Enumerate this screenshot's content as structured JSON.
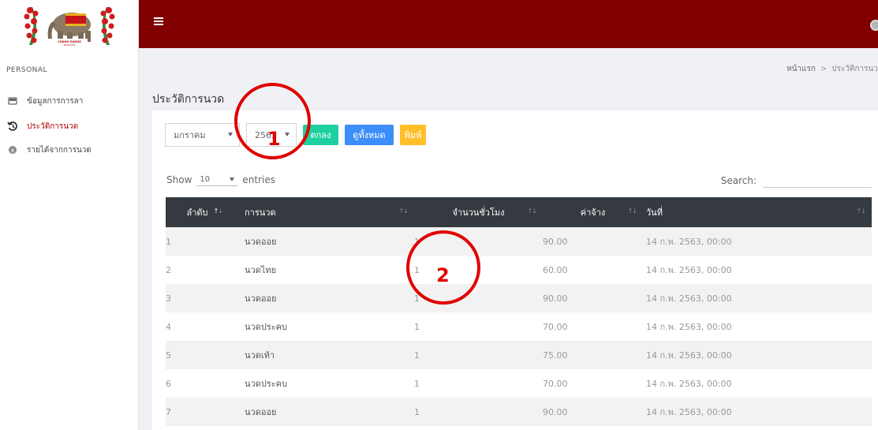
{
  "sidebar": {
    "logo_text": "CHANG DAENG MASSAGE",
    "section_label": "PERSONAL",
    "items": [
      {
        "label": "ข้อมูลการการลา",
        "icon": "card-icon",
        "active": false
      },
      {
        "label": "ประวัติการนวด",
        "icon": "history-icon",
        "active": true
      },
      {
        "label": "รายได้จากการนวด",
        "icon": "coin-icon",
        "active": false
      }
    ]
  },
  "topbar": {
    "menu_icon": "hamburger-icon",
    "avatar_icon": "user-avatar-icon",
    "color": "#800000"
  },
  "breadcrumb": {
    "home": "หน้าแรก",
    "separator": ">",
    "current": "ประวัติการนว"
  },
  "page": {
    "title": "ประวัติการนวด"
  },
  "filters": {
    "month": "มกราคม",
    "year": "2563",
    "ok_button": "ตกลง",
    "view_all_button": "ดูทั้งหมด",
    "print_button": "พิมพ์"
  },
  "datatable": {
    "show_label": "Show",
    "length_value": "10",
    "entries_label": "entries",
    "search_label": "Search:",
    "search_value": "",
    "columns": [
      "ลำดับ",
      "การนวด",
      "จำนวนชั่วโมง",
      "ค่าจ้าง",
      "วันที่"
    ],
    "rows": [
      [
        "1",
        "นวดออย",
        "1",
        "90.00",
        "14 ก.พ. 2563, 00:00"
      ],
      [
        "2",
        "นวดไทย",
        "1",
        "60.00",
        "14 ก.พ. 2563, 00:00"
      ],
      [
        "3",
        "นวดออย",
        "1",
        "90.00",
        "14 ก.พ. 2563, 00:00"
      ],
      [
        "4",
        "นวดประคบ",
        "1",
        "70.00",
        "14 ก.พ. 2563, 00:00"
      ],
      [
        "5",
        "นวดเท้า",
        "1",
        "75.00",
        "14 ก.พ. 2563, 00:00"
      ],
      [
        "6",
        "นวดประคบ",
        "1",
        "70.00",
        "14 ก.พ. 2563, 00:00"
      ],
      [
        "7",
        "นวดออย",
        "1",
        "90.00",
        "14 ก.พ. 2563, 00:00"
      ]
    ]
  },
  "annotations": [
    {
      "label": "1"
    },
    {
      "label": "2"
    }
  ]
}
